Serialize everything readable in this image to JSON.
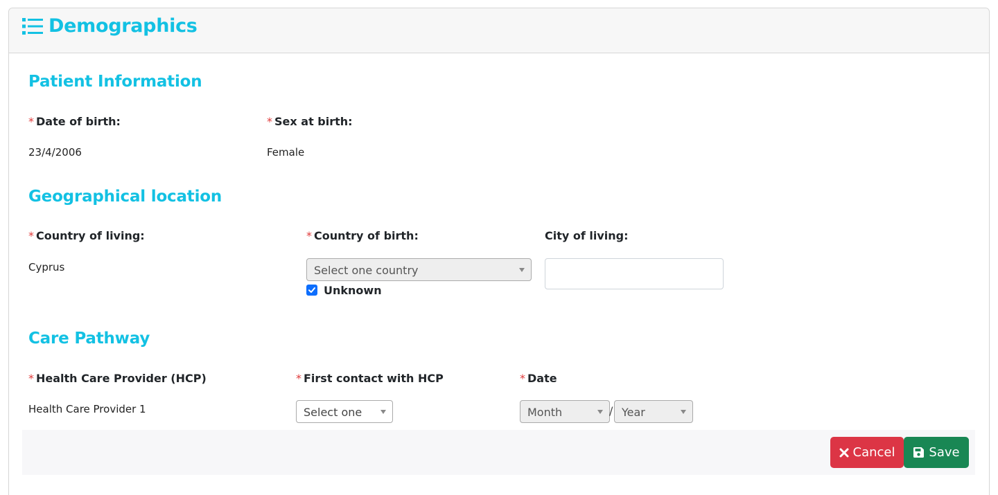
{
  "header": {
    "title": "Demographics",
    "icon": "list-icon"
  },
  "patient_info": {
    "title": "Patient Information",
    "dob_label": "Date of birth:",
    "dob_value": "23/4/2006",
    "sex_label": "Sex at birth:",
    "sex_value": "Female"
  },
  "geo": {
    "title": "Geographical location",
    "country_living_label": "Country of living:",
    "country_living_value": "Cyprus",
    "country_birth_label": "Country of birth:",
    "country_birth_select": "Select one country",
    "unknown_label": "Unknown",
    "unknown_checked": true,
    "city_label": "City of living:",
    "city_value": ""
  },
  "care": {
    "title": "Care Pathway",
    "hcp_label": "Health Care Provider (HCP)",
    "hcp_value": "Health Care Provider 1",
    "first_contact_label": "First contact with HCP",
    "first_contact_select": "Select one",
    "date_label": "Date",
    "month_select": "Month",
    "date_separator": "/",
    "year_select": "Year"
  },
  "required_marker": "*",
  "actions": {
    "cancel_label": "Cancel",
    "save_label": "Save"
  },
  "colors": {
    "accent": "#13c1e3",
    "required": "#e03a3a",
    "cancel": "#dc3545",
    "save": "#198754",
    "checkbox": "#0d6efd"
  }
}
